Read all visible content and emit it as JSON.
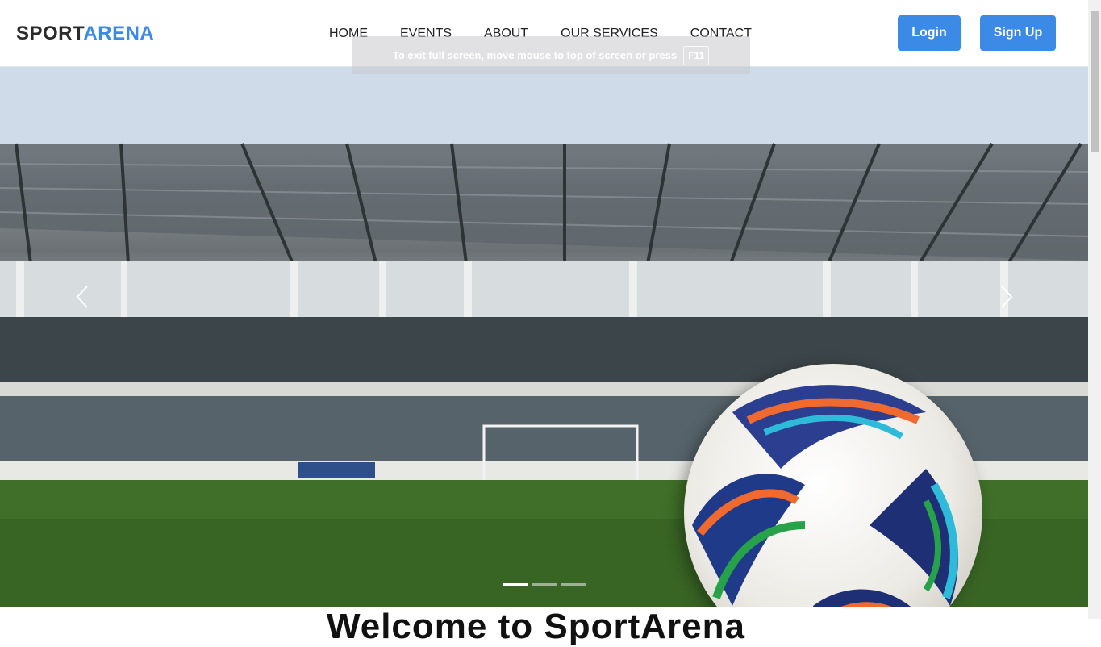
{
  "brand": {
    "part1": "SPORT",
    "part2": "ARENA"
  },
  "nav": {
    "items": [
      {
        "label": "HOME"
      },
      {
        "label": "EVENTS"
      },
      {
        "label": "ABOUT"
      },
      {
        "label": "OUR SERVICES"
      },
      {
        "label": "CONTACT"
      }
    ]
  },
  "auth": {
    "login_label": "Login",
    "signup_label": "Sign Up"
  },
  "toast": {
    "message": "To exit full screen, move mouse to top of screen or press",
    "key": "F11"
  },
  "carousel": {
    "slide_count": 3,
    "active_index": 0
  },
  "welcome": {
    "heading": "Welcome to SportArena"
  },
  "colors": {
    "accent": "#3b8ae6",
    "text": "#222222"
  }
}
